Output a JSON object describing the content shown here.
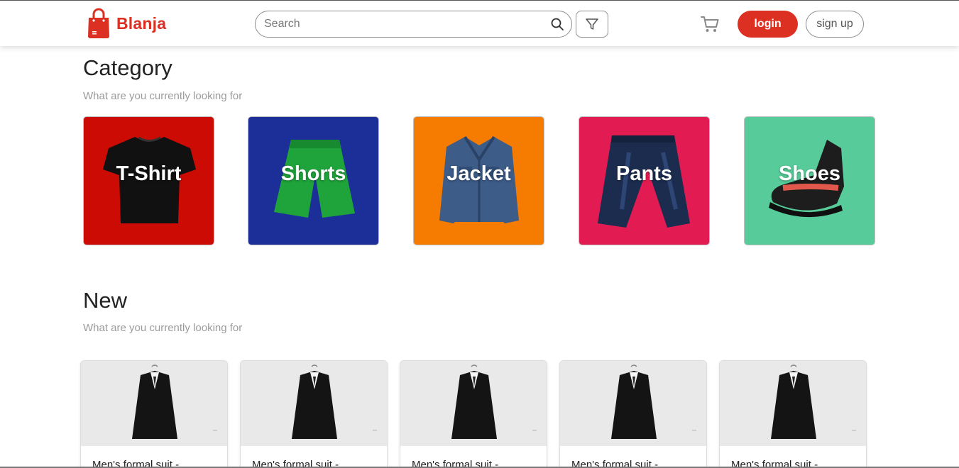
{
  "brand": {
    "name": "Blanja",
    "accent": "#db3022",
    "icon": "shopping-bag-icon"
  },
  "nav": {
    "search_placeholder": "Search",
    "login_label": "login",
    "signup_label": "sign up",
    "icons": [
      "search-icon",
      "filter-icon",
      "cart-icon"
    ]
  },
  "category": {
    "title": "Category",
    "subtitle": "What are you currently looking for",
    "items": [
      {
        "label": "T-Shirt",
        "color": "#cc0b04"
      },
      {
        "label": "Shorts",
        "color": "#1c2f99"
      },
      {
        "label": "Jacket",
        "color": "#f57c00"
      },
      {
        "label": "Pants",
        "color": "#e21c52"
      },
      {
        "label": "Shoes",
        "color": "#57cc9a"
      }
    ]
  },
  "new": {
    "title": "New",
    "subtitle": "What are you currently looking for",
    "products": [
      {
        "name": "Men's formal suit -"
      },
      {
        "name": "Men's formal suit -"
      },
      {
        "name": "Men's formal suit -"
      },
      {
        "name": "Men's formal suit -"
      },
      {
        "name": "Men's formal suit -"
      }
    ]
  }
}
